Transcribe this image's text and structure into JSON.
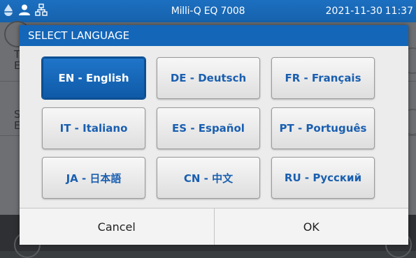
{
  "status_bar": {
    "title": "Milli-Q EQ 7008",
    "date": "2021-11-30",
    "time": "11:37",
    "icons": [
      "water-drop-icon",
      "user-icon",
      "network-icon"
    ]
  },
  "background": {
    "rows": [
      {
        "letter_1": "T",
        "letter_2": "E"
      },
      {
        "letter_1": "S",
        "letter_2": "E"
      }
    ]
  },
  "dialog": {
    "title": "SELECT LANGUAGE",
    "selected": "EN - English",
    "languages": [
      {
        "label": "EN - English"
      },
      {
        "label": "DE - Deutsch"
      },
      {
        "label": "FR - Français"
      },
      {
        "label": "IT - Italiano"
      },
      {
        "label": "ES - Español"
      },
      {
        "label": "PT - Português"
      },
      {
        "label": "JA - 日本語"
      },
      {
        "label": "CN - 中文"
      },
      {
        "label": "RU - Русский"
      }
    ],
    "cancel_label": "Cancel",
    "ok_label": "OK"
  },
  "colors": {
    "accent": "#1466b8",
    "button_text": "#1a5fb0",
    "dim_background": "#6d6f72"
  }
}
